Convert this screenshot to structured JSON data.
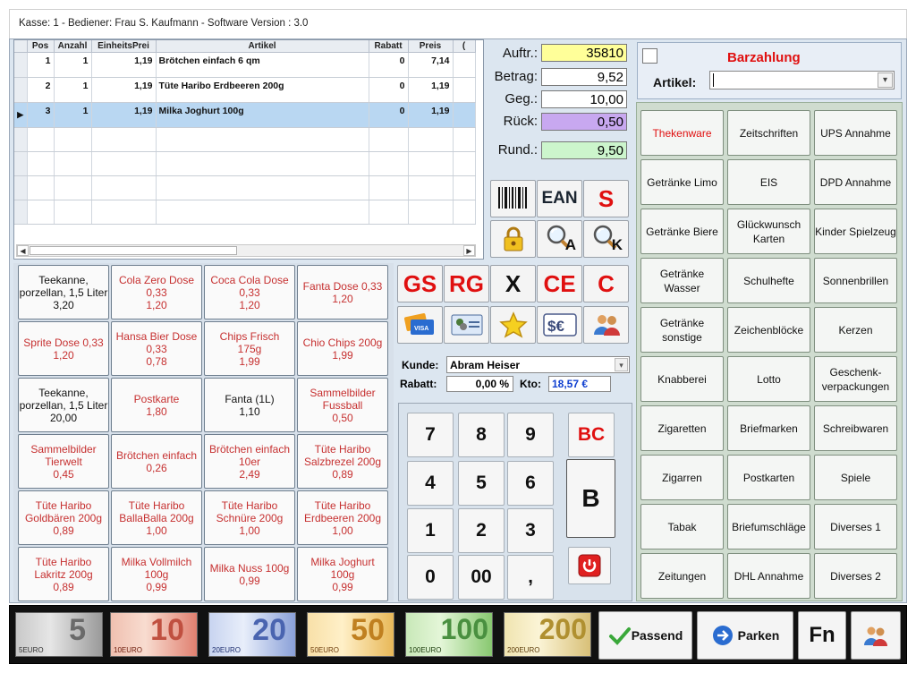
{
  "window": {
    "title": "Kasse: 1 - Bediener: Frau S. Kaufmann - Software Version : 3.0"
  },
  "grid": {
    "columns": [
      "Pos",
      "Anzahl",
      "EinheitsPrei",
      "Artikel",
      "Rabatt",
      "Preis",
      "("
    ],
    "rows": [
      {
        "pos": "1",
        "anzahl": "1",
        "einheit": "1,19",
        "artikel": "Brötchen einfach 6 qm",
        "rabatt": "0",
        "preis": "7,14"
      },
      {
        "pos": "2",
        "anzahl": "1",
        "einheit": "1,19",
        "artikel": "Tüte Haribo Erdbeeren 200g",
        "rabatt": "0",
        "preis": "1,19"
      },
      {
        "pos": "3",
        "anzahl": "1",
        "einheit": "1,19",
        "artikel": "Milka Joghurt 100g",
        "rabatt": "0",
        "preis": "1,19"
      }
    ]
  },
  "totals": {
    "auftr_label": "Auftr.:",
    "auftr": "35810",
    "betrag_label": "Betrag:",
    "betrag": "9,52",
    "geg_label": "Geg.:",
    "geg": "10,00",
    "rueck_label": "Rück:",
    "rueck": "0,50",
    "rund_label": "Rund.:",
    "rund": "9,50"
  },
  "payment": {
    "title": "Barzahlung",
    "artikel_label": "Artikel:",
    "artikel_value": ""
  },
  "categories": [
    "Thekenware",
    "Zeitschriften",
    "UPS Annahme",
    "Getränke Limo",
    "EIS",
    "DPD Annahme",
    "Getränke Biere",
    "Glückwunsch Karten",
    "Kinder Spielzeug",
    "Getränke Wasser",
    "Schulhefte",
    "Sonnenbrillen",
    "Getränke sonstige",
    "Zeichenblöcke",
    "Kerzen",
    "Knabberei",
    "Lotto",
    "Geschenk-verpackungen",
    "Zigaretten",
    "Briefmarken",
    "Schreibwaren",
    "Zigarren",
    "Postkarten",
    "Spiele",
    "Tabak",
    "Briefumschläge",
    "Diverses 1",
    "Zeitungen",
    "DHL Annahme",
    "Diverses 2"
  ],
  "products": [
    {
      "name": "Teekanne, porzellan, 1,5 Liter",
      "price": "3,20",
      "black": true
    },
    {
      "name": "Cola Zero Dose",
      "size": "0,33",
      "price": "1,20"
    },
    {
      "name": "Coca Cola Dose",
      "size": "0,33",
      "price": "1,20"
    },
    {
      "name": "Fanta Dose 0,33",
      "price": "1,20"
    },
    {
      "name": "Sprite Dose 0,33",
      "price": "1,20"
    },
    {
      "name": "Hansa Bier Dose",
      "size": "0,33",
      "price": "0,78"
    },
    {
      "name": "Chips Frisch",
      "size": "175g",
      "price": "1,99"
    },
    {
      "name": "Chio Chips 200g",
      "price": "1,99"
    },
    {
      "name": "Teekanne, porzellan, 1,5 Liter",
      "price": "20,00",
      "black": true
    },
    {
      "name": "Postkarte",
      "price": "1,80"
    },
    {
      "name": "Fanta (1L)",
      "price": "1,10",
      "black": true
    },
    {
      "name": "Sammelbilder Fussball",
      "price": "0,50"
    },
    {
      "name": "Sammelbilder Tierwelt",
      "price": "0,45"
    },
    {
      "name": "Brötchen einfach",
      "price": "0,26"
    },
    {
      "name": "Brötchen einfach 10er",
      "price": "2,49"
    },
    {
      "name": "Tüte Haribo Salzbrezel 200g",
      "price": "0,89"
    },
    {
      "name": "Tüte Haribo Goldbären 200g",
      "price": "0,89"
    },
    {
      "name": "Tüte Haribo BallaBalla 200g",
      "price": "1,00"
    },
    {
      "name": "Tüte Haribo Schnüre 200g",
      "price": "1,00"
    },
    {
      "name": "Tüte Haribo Erdbeeren 200g",
      "price": "1,00"
    },
    {
      "name": "Tüte Haribo Lakritz 200g",
      "price": "0,89"
    },
    {
      "name": "Milka Vollmilch 100g",
      "price": "0,99"
    },
    {
      "name": "Milka Nuss 100g",
      "price": "0,99"
    },
    {
      "name": "Milka Joghurt 100g",
      "price": "0,99"
    }
  ],
  "functions": {
    "ean": "EAN",
    "s": "S",
    "gs": "GS",
    "rg": "RG",
    "x": "X",
    "ce": "CE",
    "c": "C",
    "search_a": "A",
    "search_k": "K"
  },
  "kunde": {
    "label": "Kunde:",
    "value": "Abram Heiser",
    "rabatt_label": "Rabatt:",
    "rabatt": "0,00 %",
    "kto_label": "Kto:",
    "kto": "18,57 €"
  },
  "numpad": {
    "k7": "7",
    "k8": "8",
    "k9": "9",
    "bc": "BC",
    "k4": "4",
    "k5": "5",
    "k6": "6",
    "b": "B",
    "k1": "1",
    "k2": "2",
    "k3": "3",
    "k0": "0",
    "k00": "00",
    "comma": ","
  },
  "bottom": {
    "notes": [
      {
        "value": "5",
        "label": "5EURO"
      },
      {
        "value": "10",
        "label": "10EURO"
      },
      {
        "value": "20",
        "label": "20EURO"
      },
      {
        "value": "50",
        "label": "50EURO"
      },
      {
        "value": "100",
        "label": "100EURO"
      },
      {
        "value": "200",
        "label": "200EURO"
      }
    ],
    "passend": "Passend",
    "parken": "Parken",
    "fn": "Fn"
  },
  "colors": {
    "auftr_bg": "#ffff99",
    "rueck_bg": "#c8a8f0",
    "rund_bg": "#ccf5cc",
    "accent_red": "#e01010"
  }
}
